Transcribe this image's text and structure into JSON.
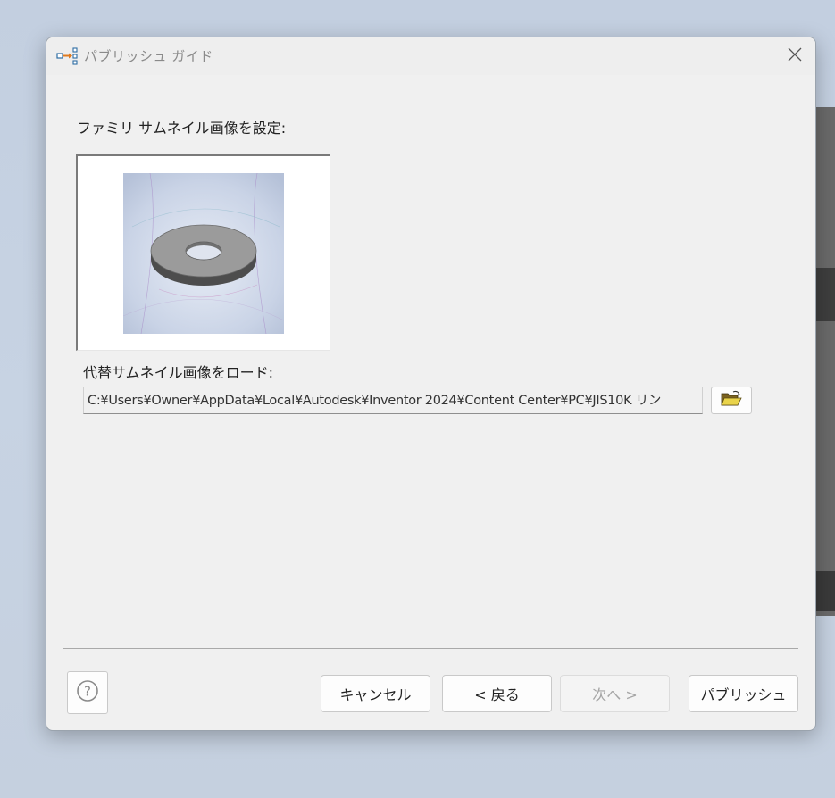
{
  "window": {
    "title": "パブリッシュ ガイド",
    "icon": "publish-guide-icon",
    "close_icon": "close-icon"
  },
  "thumbnail_section": {
    "label": "ファミリ サムネイル画像を設定:"
  },
  "alternate_section": {
    "label": "代替サムネイル画像をロード:",
    "path_value": "C:¥Users¥Owner¥AppData¥Local¥Autodesk¥Inventor 2024¥Content Center¥PC¥JIS10K リン",
    "browse_icon": "folder-open-icon"
  },
  "footer": {
    "help_icon": "question-icon",
    "cancel_label": "キャンセル",
    "back_label": "< 戻る",
    "next_label": "次へ >",
    "publish_label": "パブリッシュ",
    "next_enabled": false
  },
  "colors": {
    "dialog_bg": "#f0f0f0",
    "accent_orange": "#e07b20",
    "icon_blue": "#2e6da4"
  }
}
